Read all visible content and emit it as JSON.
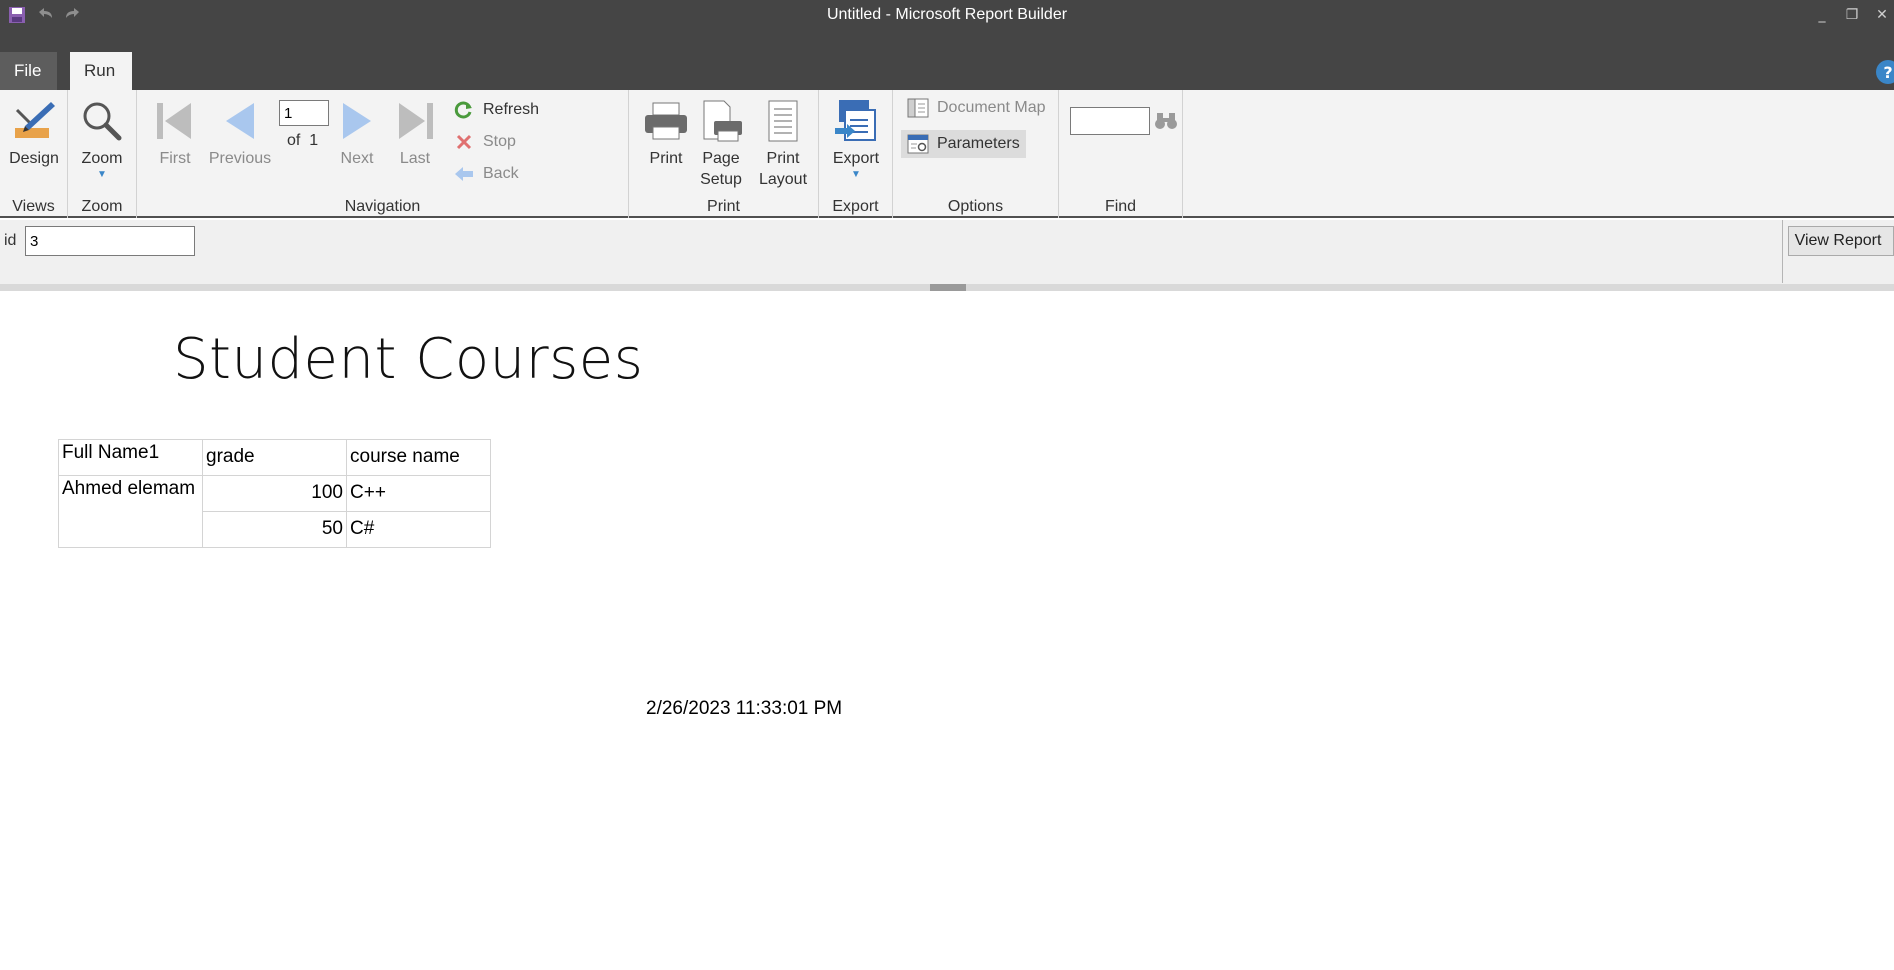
{
  "window": {
    "title": "Untitled - Microsoft Report Builder",
    "controls": {
      "minimize": "_",
      "restore": "❐",
      "close": "✕"
    }
  },
  "quick_access": {
    "icons": [
      "save-icon",
      "undo-icon",
      "redo-icon"
    ]
  },
  "tabs": [
    {
      "label": "File"
    },
    {
      "label": "Run"
    }
  ],
  "help": {
    "label": "?"
  },
  "ribbon": {
    "views": {
      "group_label": "Views",
      "design_label": "Design"
    },
    "zoom": {
      "group_label": "Zoom",
      "zoom_label": "Zoom"
    },
    "navigation": {
      "group_label": "Navigation",
      "first_label": "First",
      "previous_label": "Previous",
      "page_value": "1",
      "of_label": "of",
      "total_pages": "1",
      "next_label": "Next",
      "last_label": "Last",
      "refresh_label": "Refresh",
      "stop_label": "Stop",
      "back_label": "Back"
    },
    "print": {
      "group_label": "Print",
      "print_label": "Print",
      "page_setup_line1": "Page",
      "page_setup_line2": "Setup",
      "print_layout_line1": "Print",
      "print_layout_line2": "Layout"
    },
    "export": {
      "group_label": "Export",
      "export_label": "Export"
    },
    "options": {
      "group_label": "Options",
      "document_map_label": "Document Map",
      "parameters_label": "Parameters"
    },
    "find": {
      "group_label": "Find",
      "value": ""
    }
  },
  "parameters_bar": {
    "param_label": "id",
    "param_value": "3",
    "view_report_label": "View Report"
  },
  "report": {
    "title": "Student Courses",
    "table": {
      "headers": [
        "Full Name1",
        "grade",
        "course name"
      ],
      "group_name": "Ahmed elemam",
      "rows": [
        {
          "grade": "100",
          "course": "C++"
        },
        {
          "grade": "50",
          "course": "C#"
        }
      ]
    },
    "timestamp": "2/26/2023 11:33:01 PM"
  },
  "colors": {
    "titlebar": "#454545",
    "ribbon": "#f3f3f3",
    "accent_blue": "#3a86c8"
  }
}
